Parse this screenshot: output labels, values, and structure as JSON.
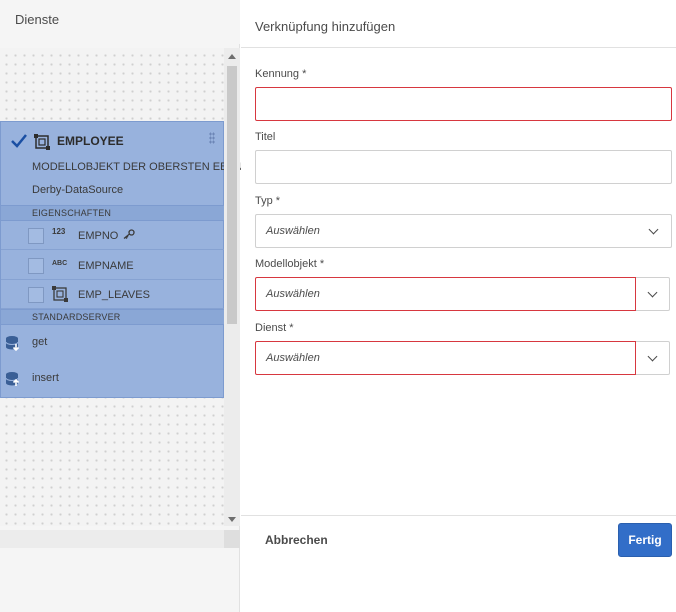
{
  "left_panel": {
    "title": "Dienste",
    "model": {
      "name": "EMPLOYEE",
      "subtitle": "MODELLOBJEKT DER OBERSTEN EBENE",
      "data_source": "Derby-DataSource",
      "properties_header": "EIGENSCHAFTEN",
      "properties": [
        {
          "type": "123",
          "name": "EMPNO",
          "is_key": true
        },
        {
          "type": "ABC",
          "name": "EMPNAME",
          "is_key": false
        },
        {
          "type": "entity",
          "name": "EMP_LEAVES",
          "is_key": false
        }
      ],
      "services_header": "STANDARDSERVER",
      "services": [
        {
          "name": "get",
          "icon": "database-download-icon"
        },
        {
          "name": "insert",
          "icon": "database-upload-icon"
        }
      ]
    }
  },
  "dialog": {
    "title": "Verknüpfung hinzufügen",
    "fields": {
      "kennung": {
        "label": "Kennung *",
        "value": ""
      },
      "titel": {
        "label": "Titel",
        "value": ""
      },
      "typ": {
        "label": "Typ *",
        "placeholder": "Auswählen"
      },
      "modellobjekt": {
        "label": "Modellobjekt *",
        "placeholder": "Auswählen"
      },
      "dienst": {
        "label": "Dienst *",
        "placeholder": "Auswählen"
      }
    },
    "cancel_label": "Abbrechen",
    "done_label": "Fertig"
  },
  "colors": {
    "accent": "#326ec8",
    "error": "#d7373f",
    "selection": "#98b2dd"
  }
}
